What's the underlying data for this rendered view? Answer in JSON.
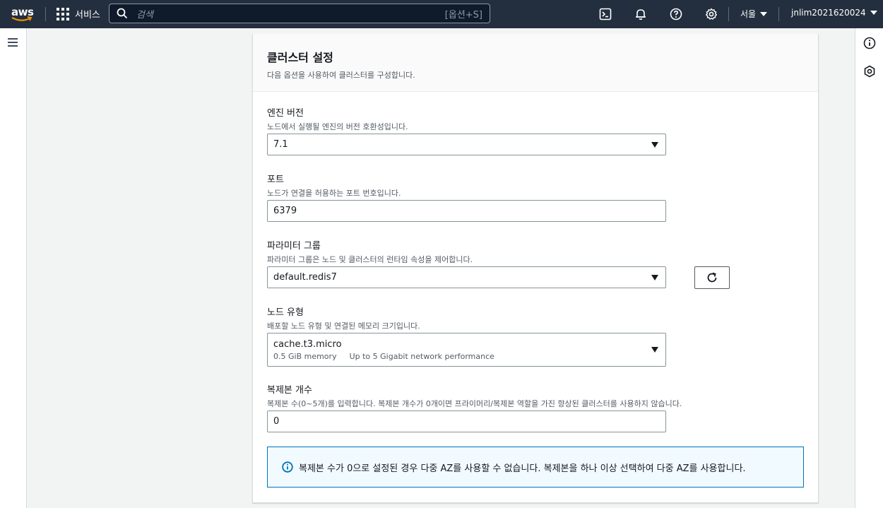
{
  "nav": {
    "logo_text": "aws",
    "services_label": "서비스",
    "search_placeholder": "검색",
    "search_shortcut": "[옵션+S]",
    "region_label": "서울",
    "account_label": "jnlim2021620024"
  },
  "panel": {
    "title": "클러스터 설정",
    "description": "다음 옵션을 사용하여 클러스터를 구성합니다."
  },
  "fields": {
    "engine_version": {
      "label": "엔진 버전",
      "description": "노드에서 실행될 엔진의 버전 호환성입니다.",
      "value": "7.1"
    },
    "port": {
      "label": "포트",
      "description": "노드가 연결을 허용하는 포트 번호입니다.",
      "value": "6379"
    },
    "parameter_group": {
      "label": "파라미터 그룹",
      "description": "파라미터 그룹은 노드 및 클러스터의 런타임 속성을 제어합니다.",
      "value": "default.redis7"
    },
    "node_type": {
      "label": "노드 유형",
      "description": "배포할 노드 유형 및 연결된 메모리 크기입니다.",
      "value": "cache.t3.micro",
      "memory": "0.5 GiB memory",
      "network": "Up to 5 Gigabit network performance"
    },
    "replicas": {
      "label": "복제본 개수",
      "description": "복제본 수(0~5개)를 입력합니다. 복제본 개수가 0개이면 프라이머리/복제본 역할을 가진 향상된 클러스터를 사용하지 않습니다.",
      "value": "0"
    }
  },
  "info_message": "복제본 수가 0으로 설정된 경우 다중 AZ를 사용할 수 없습니다. 복제본을 하나 이상 선택하여 다중 AZ를 사용합니다.",
  "colors": {
    "nav_bg": "#232f3e",
    "info_border": "#0073bb",
    "info_bg": "#f1faff",
    "aws_orange": "#ff9900"
  }
}
